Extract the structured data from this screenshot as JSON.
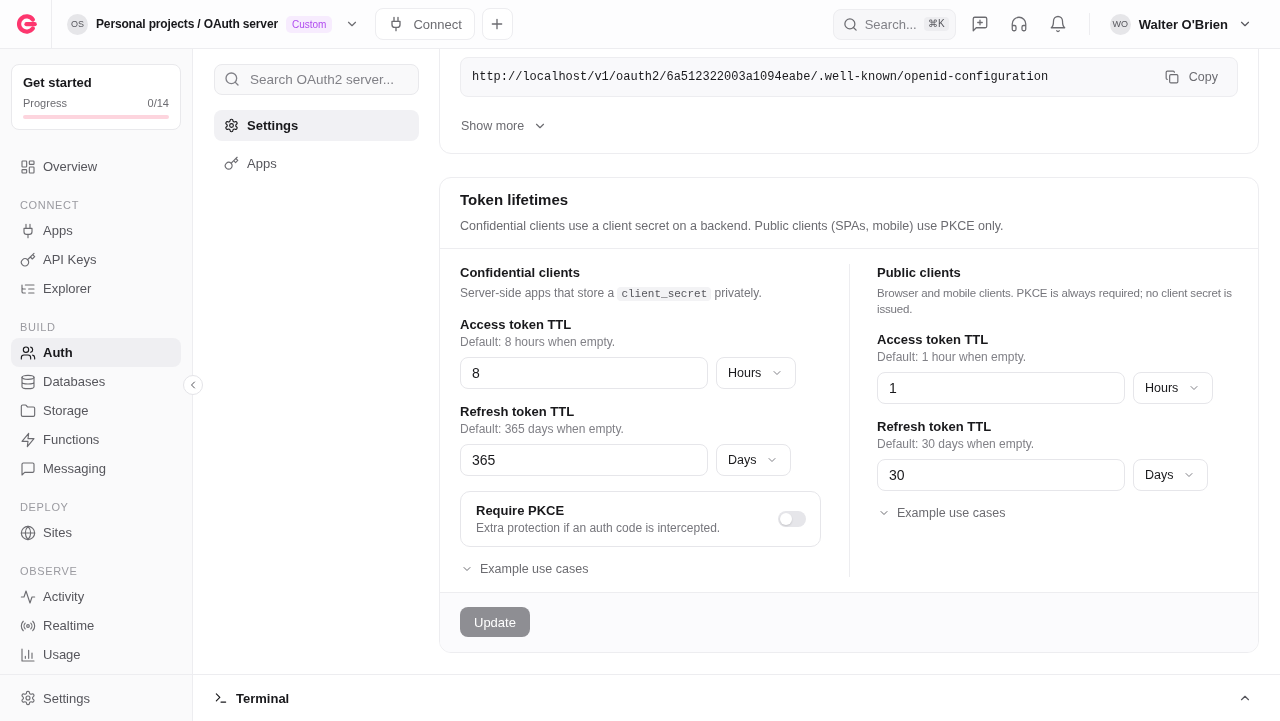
{
  "top_bar": {
    "project": {
      "initials": "OS",
      "path": "Personal projects / OAuth server",
      "badge": "Custom"
    },
    "connect": "Connect",
    "search": {
      "placeholder": "Search...",
      "shortcut": "⌘K"
    },
    "user": {
      "initials": "WO",
      "name": "Walter O'Brien"
    }
  },
  "sidebar": {
    "get_started": {
      "title": "Get started",
      "progress_label": "Progress",
      "count": "0/14",
      "level": 0
    },
    "sections": [
      {
        "items": [
          {
            "label": "Overview",
            "selected": false
          }
        ]
      },
      {
        "heading": "CONNECT",
        "items": [
          {
            "label": "Apps",
            "selected": false
          },
          {
            "label": "API Keys",
            "selected": false
          },
          {
            "label": "Explorer",
            "selected": false
          }
        ]
      },
      {
        "heading": "BUILD",
        "items": [
          {
            "label": "Auth",
            "selected": true
          },
          {
            "label": "Databases",
            "selected": false
          },
          {
            "label": "Storage",
            "selected": false
          },
          {
            "label": "Functions",
            "selected": false
          },
          {
            "label": "Messaging",
            "selected": false
          }
        ]
      },
      {
        "heading": "DEPLOY",
        "items": [
          {
            "label": "Sites",
            "selected": false
          }
        ]
      },
      {
        "heading": "OBSERVE",
        "items": [
          {
            "label": "Activity",
            "selected": false
          },
          {
            "label": "Realtime",
            "selected": false
          },
          {
            "label": "Usage",
            "selected": false
          }
        ]
      }
    ],
    "footer": {
      "label": "Settings"
    }
  },
  "subnav": {
    "search": {
      "placeholder": "Search OAuth2 server..."
    },
    "items": [
      {
        "label": "Settings",
        "selected": true
      },
      {
        "label": "Apps",
        "selected": false
      }
    ]
  },
  "endpoint_card": {
    "url": "http://localhost/v1/oauth2/6a512322003a1094eabe/.well-known/openid-configuration",
    "copy": "Copy",
    "show_more": {
      "label": "Show more",
      "expanded": false
    }
  },
  "token_card": {
    "title": "Token lifetimes",
    "description": "Confidential clients use a client secret on a backend. Public clients (SPAs, mobile) use PKCE only.",
    "columns": [
      {
        "title": "Confidential clients",
        "description": [
          {
            "kind": "text",
            "text": "Server-side apps that store a"
          },
          {
            "kind": "code",
            "text": "client_secret"
          },
          {
            "kind": "text",
            "text": "privately."
          }
        ],
        "fields": [
          {
            "label": "Access token TTL",
            "hint": "Default: 8 hours when empty.",
            "value": "8",
            "unit": "Hours"
          },
          {
            "label": "Refresh token TTL",
            "hint": "Default: 365 days when empty.",
            "value": "365",
            "unit": "Days"
          }
        ],
        "toggle": {
          "title": "Require PKCE",
          "description": "Extra protection if an auth code is intercepted.",
          "on": false
        },
        "examples": {
          "label": "Example use cases",
          "expanded": false
        }
      },
      {
        "title": "Public clients",
        "description": [
          {
            "kind": "text",
            "text": "Browser and mobile clients. PKCE is always required; no client secret is issued."
          }
        ],
        "fields": [
          {
            "label": "Access token TTL",
            "hint": "Default: 1 hour when empty.",
            "value": "1",
            "unit": "Hours"
          },
          {
            "label": "Refresh token TTL",
            "hint": "Default: 30 days when empty.",
            "value": "30",
            "unit": "Days"
          }
        ],
        "examples": {
          "label": "Example use cases",
          "expanded": false
        }
      }
    ],
    "update": {
      "label": "Update",
      "disabled": true
    }
  },
  "terminal": {
    "label": "Terminal"
  }
}
